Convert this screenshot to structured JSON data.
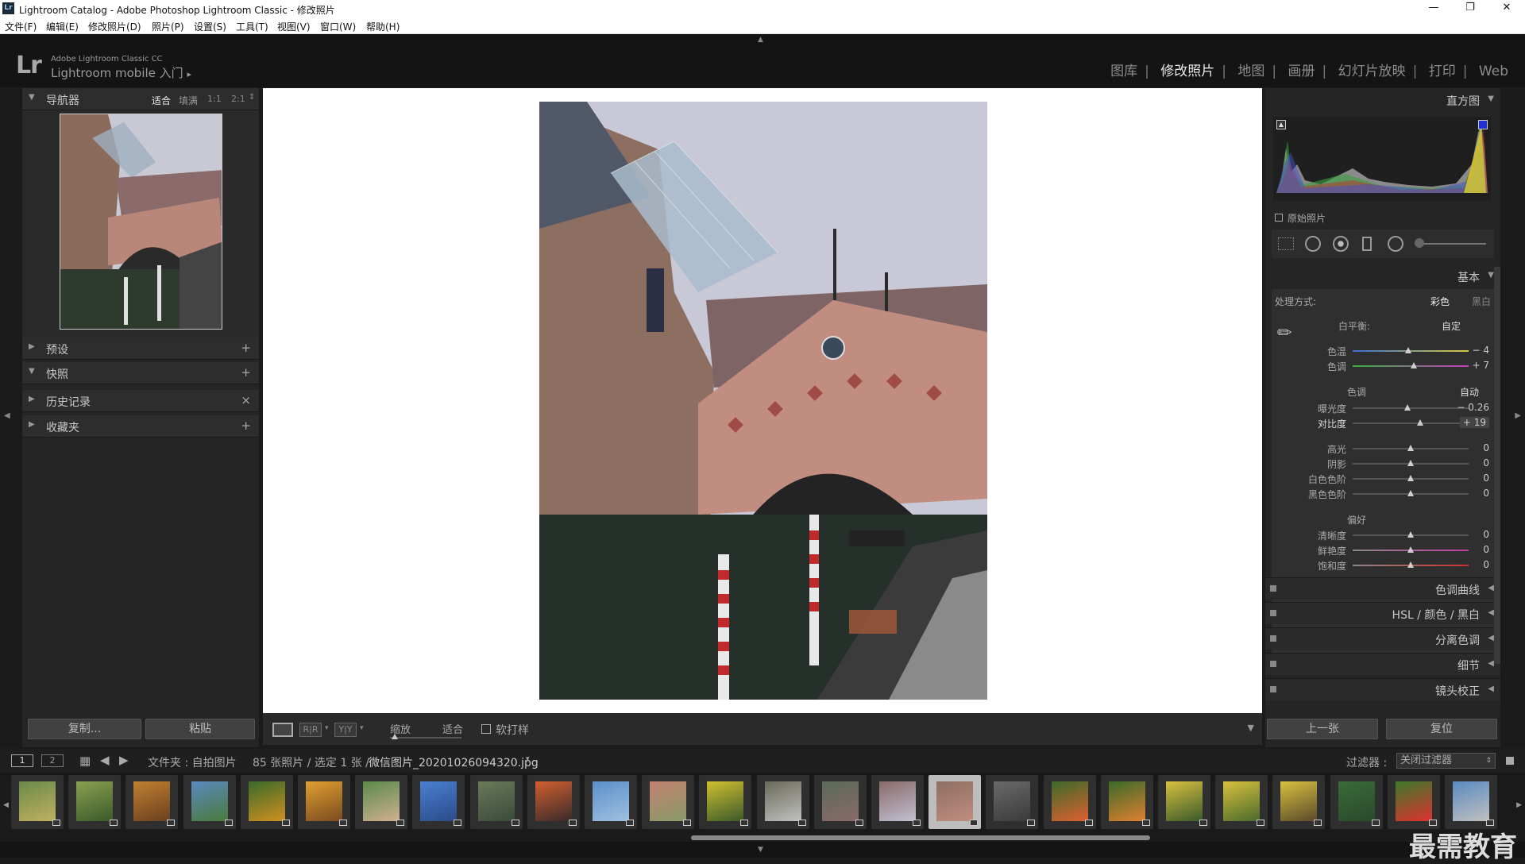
{
  "window": {
    "title": "Lightroom Catalog - Adobe Photoshop Lightroom Classic - 修改照片"
  },
  "menu": [
    "文件(F)",
    "编辑(E)",
    "修改照片(D)",
    "照片(P)",
    "设置(S)",
    "工具(T)",
    "视图(V)",
    "窗口(W)",
    "帮助(H)"
  ],
  "identity": {
    "logo": "Lr",
    "line1": "Adobe Lightroom Classic CC",
    "line2": "Lightroom mobile 入门",
    "arrow": "▸"
  },
  "modules": [
    "图库",
    "修改照片",
    "地图",
    "画册",
    "幻灯片放映",
    "打印",
    "Web"
  ],
  "modules_sep": "|",
  "navigator": {
    "title": "导航器",
    "modes": [
      "适合",
      "填满",
      "1:1",
      "2:1"
    ]
  },
  "left_panels": [
    {
      "label": "预设",
      "action": "+"
    },
    {
      "label": "快照",
      "action": "+"
    },
    {
      "label": "历史记录",
      "action": "×"
    },
    {
      "label": "收藏夹",
      "action": "+"
    }
  ],
  "left_buttons": {
    "copy": "复制...",
    "paste": "粘贴"
  },
  "toolbar": {
    "zoom_label": "缩放",
    "zoom_value": "适合",
    "softproof": "软打样"
  },
  "histogram": {
    "title": "直方图",
    "original_photo": "原始照片"
  },
  "basic": {
    "title": "基本",
    "treatment_label": "处理方式:",
    "treatment_color": "彩色",
    "treatment_bw": "黑白",
    "wb_label": "白平衡:",
    "wb_value": "自定",
    "tone_label": "色调",
    "auto": "自动",
    "presence_label": "偏好",
    "sliders": [
      {
        "label": "色温",
        "value": "− 4",
        "pos": 0.48
      },
      {
        "label": "色调",
        "value": "+ 7",
        "pos": 0.53
      },
      {
        "label": "曝光度",
        "value": "− 0.26",
        "pos": 0.47
      },
      {
        "label": "对比度",
        "value": "+ 19",
        "pos": 0.58
      },
      {
        "label": "高光",
        "value": "0",
        "pos": 0.5
      },
      {
        "label": "阴影",
        "value": "0",
        "pos": 0.5
      },
      {
        "label": "白色色阶",
        "value": "0",
        "pos": 0.5
      },
      {
        "label": "黑色色阶",
        "value": "0",
        "pos": 0.5
      },
      {
        "label": "清晰度",
        "value": "0",
        "pos": 0.5
      },
      {
        "label": "鲜艳度",
        "value": "0",
        "pos": 0.5
      },
      {
        "label": "饱和度",
        "value": "0",
        "pos": 0.5
      }
    ]
  },
  "right_sections": [
    "色调曲线",
    "HSL  /  颜色  /  黑白",
    "分离色调",
    "细节",
    "镜头校正"
  ],
  "right_buttons": {
    "prev": "上一张",
    "reset": "复位"
  },
  "filmstrip_bar": {
    "views": [
      "1",
      "2"
    ],
    "path": "文件夹 : 自拍图片",
    "count": "85 张照片 / 选定 1 张 /",
    "filename": "微信图片_20201026094320.jpg",
    "filter_label": "过滤器 :",
    "filter_value": "关闭过滤器"
  },
  "filmstrip_count": 26,
  "filmstrip_selected": 16,
  "watermark": "最需教育"
}
